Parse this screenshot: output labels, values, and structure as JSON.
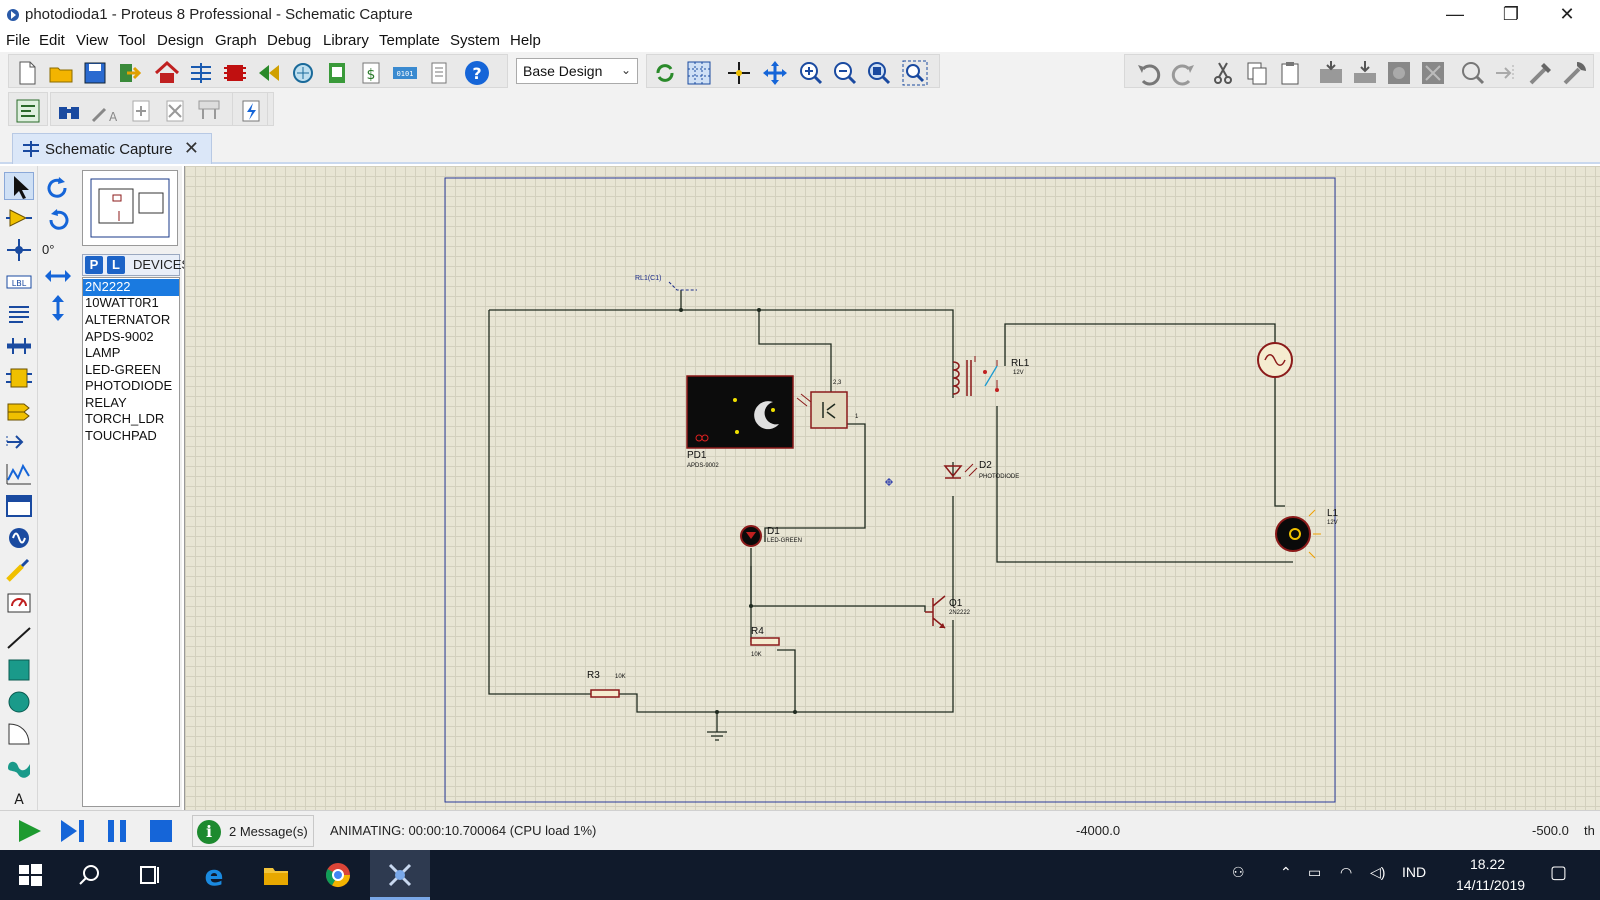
{
  "window": {
    "title": "photodioda1 - Proteus 8 Professional - Schematic Capture",
    "minimize": "—",
    "restore": "❐",
    "close": "✕"
  },
  "menu": [
    "File",
    "Edit",
    "View",
    "Tool",
    "Design",
    "Graph",
    "Debug",
    "Library",
    "Template",
    "System",
    "Help"
  ],
  "toolbar": {
    "design_combo": "Base Design"
  },
  "tabs": [
    {
      "label": "Schematic Capture",
      "close": "✕"
    }
  ],
  "side_panel": {
    "angle": "0°",
    "p_button": "P",
    "l_button": "L",
    "devices_label": "DEVICES",
    "devices": [
      "2N2222",
      "10WATT0R1",
      "ALTERNATOR",
      "APDS-9002",
      "LAMP",
      "LED-GREEN",
      "PHOTODIODE",
      "RELAY",
      "TORCH_LDR",
      "TOUCHPAD"
    ],
    "selected_device": "2N2222"
  },
  "schematic": {
    "net_label": "RL1(C1)",
    "pd1_ref": "PD1",
    "pd1_value": "APDS-9002",
    "pd1_pins": "2,3",
    "pd1_pin1": "1",
    "rl1_ref": "RL1",
    "rl1_value": "12V",
    "d2_ref": "D2",
    "d2_value": "PHOTODIODE",
    "d1_ref": "D1",
    "d1_value": "LED-GREEN",
    "l1_ref": "L1",
    "l1_value": "12V",
    "q1_ref": "Q1",
    "q1_value": "2N2222",
    "r4_ref": "R4",
    "r4_value": "10K",
    "r3_ref": "R3",
    "r3_value": "10K"
  },
  "status": {
    "messages": "2 Message(s)",
    "message_icon": "i",
    "animating": "ANIMATING: 00:00:10.700064 (CPU load 1%)",
    "coord_x": "-4000.0",
    "coord_y": "-500.0",
    "coord_unit": "th"
  },
  "taskbar": {
    "language": "IND",
    "time": "18.22",
    "date": "14/11/2019"
  },
  "colors": {
    "accent": "#1a7ae0",
    "wire": "#1f2a1f",
    "component": "#8b1a1a",
    "canvas": "#e8e5d4",
    "taskbar": "#101a2b"
  }
}
